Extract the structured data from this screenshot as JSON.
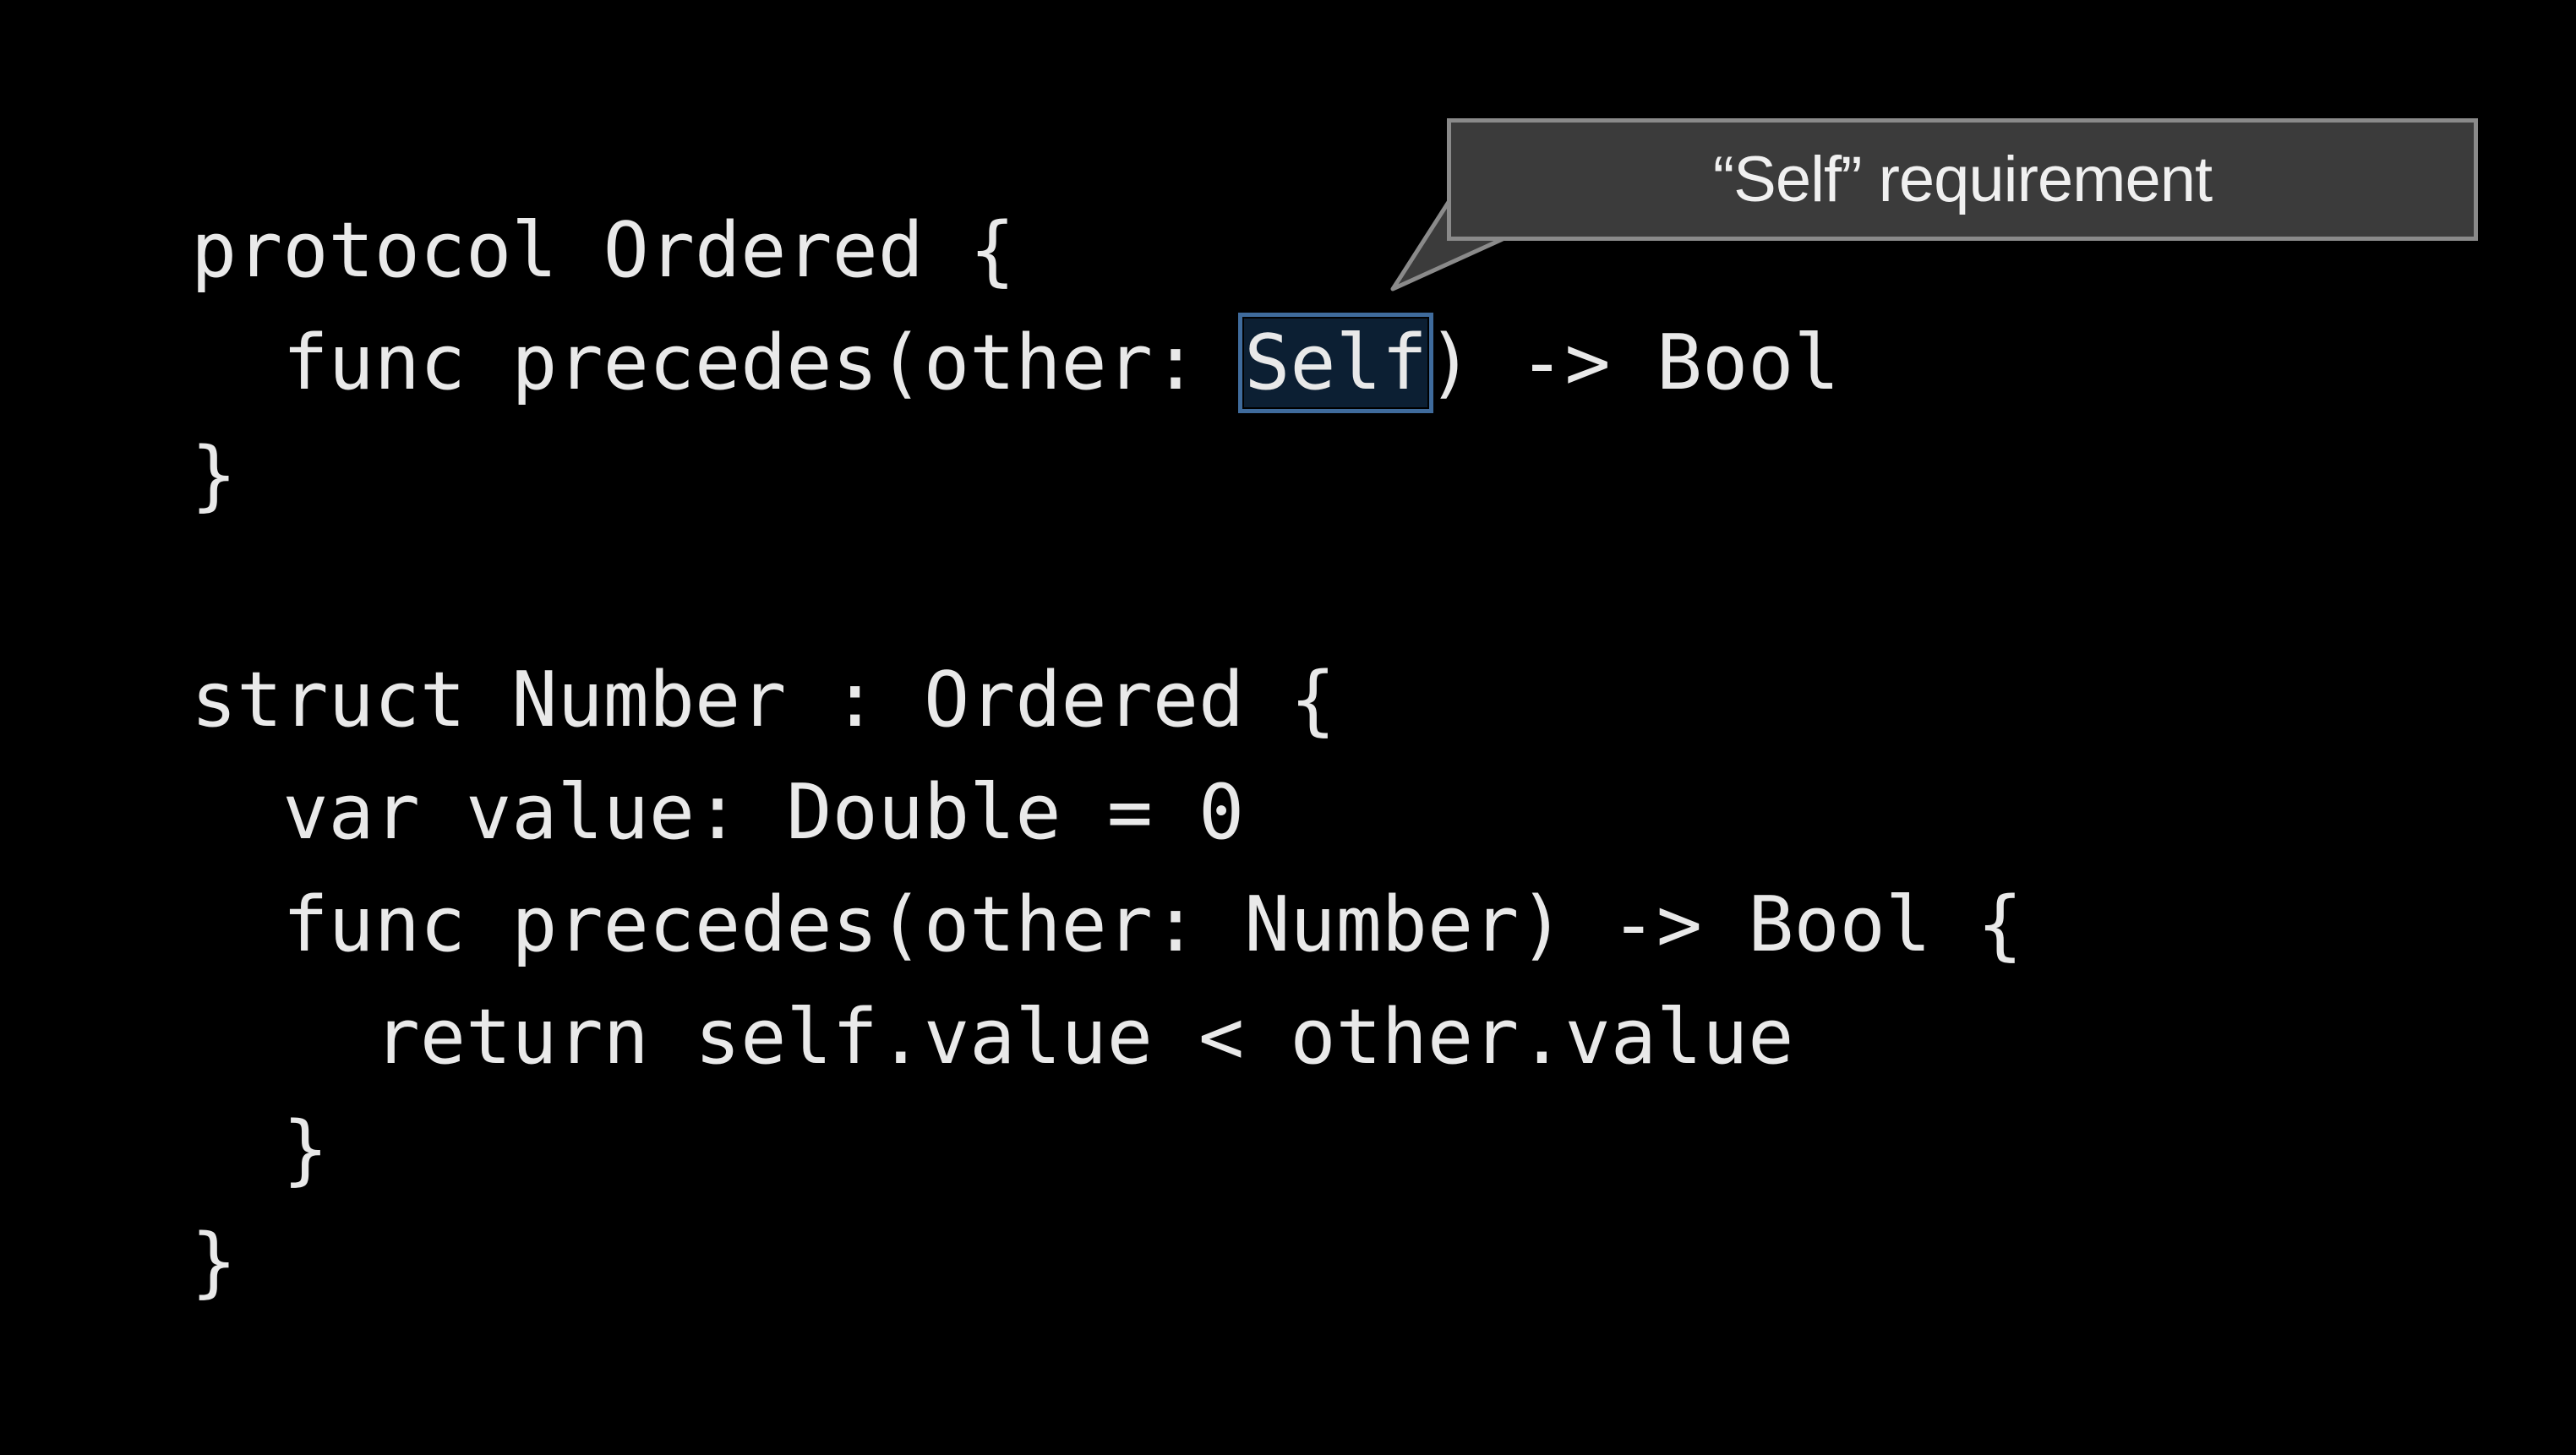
{
  "callout": {
    "text": "“Self” requirement"
  },
  "code": {
    "lines": [
      {
        "text": "protocol Ordered {"
      },
      {
        "prefix": "  func precedes(other: ",
        "highlight": "Self",
        "suffix": ") -> Bool"
      },
      {
        "text": "}"
      },
      {
        "text": ""
      },
      {
        "text": "struct Number : Ordered {"
      },
      {
        "text": "  var value: Double = 0"
      },
      {
        "text": "  func precedes(other: Number) -> Bool {"
      },
      {
        "text": "    return self.value < other.value"
      },
      {
        "text": "  }"
      },
      {
        "text": "}"
      }
    ]
  },
  "colors": {
    "background": "#000000",
    "code_text": "#e9e9e9",
    "highlight_border": "#3f6b9c",
    "callout_fill": "#3b3b3b",
    "callout_border": "#8a8a8a"
  }
}
